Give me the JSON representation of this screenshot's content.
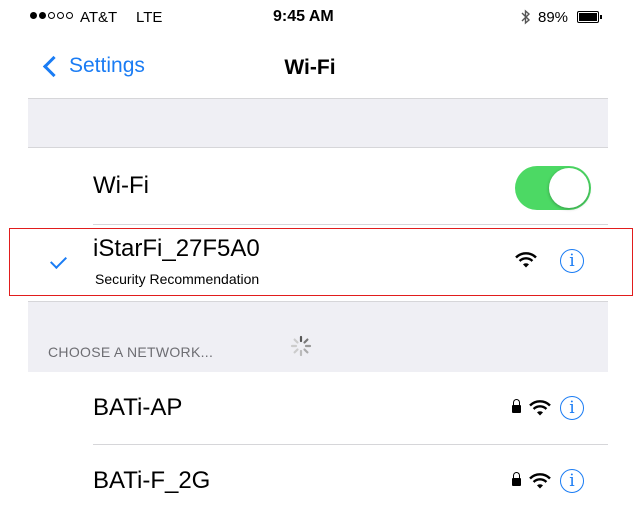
{
  "status_bar": {
    "carrier": "AT&T",
    "network_type": "LTE",
    "time": "9:45 AM",
    "bluetooth_icon": "bluetooth-icon",
    "battery_percent": "89%"
  },
  "nav": {
    "back_label": "Settings",
    "title": "Wi-Fi"
  },
  "wifi_toggle": {
    "label": "Wi-Fi",
    "state": "on",
    "accent_color": "#4cd964"
  },
  "connected_network": {
    "name": "iStarFi_27F5A0",
    "subtitle": "Security Recommendation"
  },
  "section_header": "CHOOSE A NETWORK...",
  "networks": [
    {
      "name": "BATi-AP",
      "secured": true
    },
    {
      "name": "BATi-F_2G",
      "secured": true
    }
  ],
  "colors": {
    "ios_blue": "#1a7cf4",
    "highlight_red": "#e11d1d",
    "group_background": "#efeff4"
  }
}
